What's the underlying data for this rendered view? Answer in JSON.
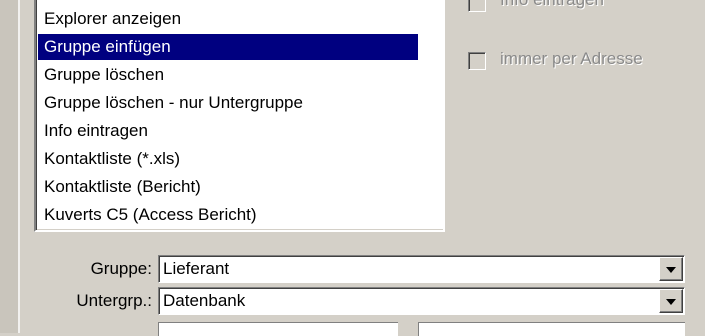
{
  "list": {
    "items": [
      "Explorer anzeigen",
      "Gruppe einfügen",
      "Gruppe löschen",
      "Gruppe löschen - nur Untergruppe",
      "Info eintragen",
      "Kontaktliste (*.xls)",
      "Kontaktliste (Bericht)",
      "Kuverts C5 (Access Bericht)"
    ],
    "selected_index": 1
  },
  "options": {
    "top_checkbox_label": "Info eintragen",
    "immer_per_adresse_label": "immer per Adresse"
  },
  "form": {
    "gruppe_label": "Gruppe:",
    "gruppe_value": "Lieferant",
    "untergruppe_label": "Untergrp.:",
    "untergruppe_value": "Datenbank"
  },
  "colors": {
    "dialog_bg": "#d4d0c8",
    "selection_bg": "#000080",
    "disabled_text": "#8a8a8a"
  }
}
